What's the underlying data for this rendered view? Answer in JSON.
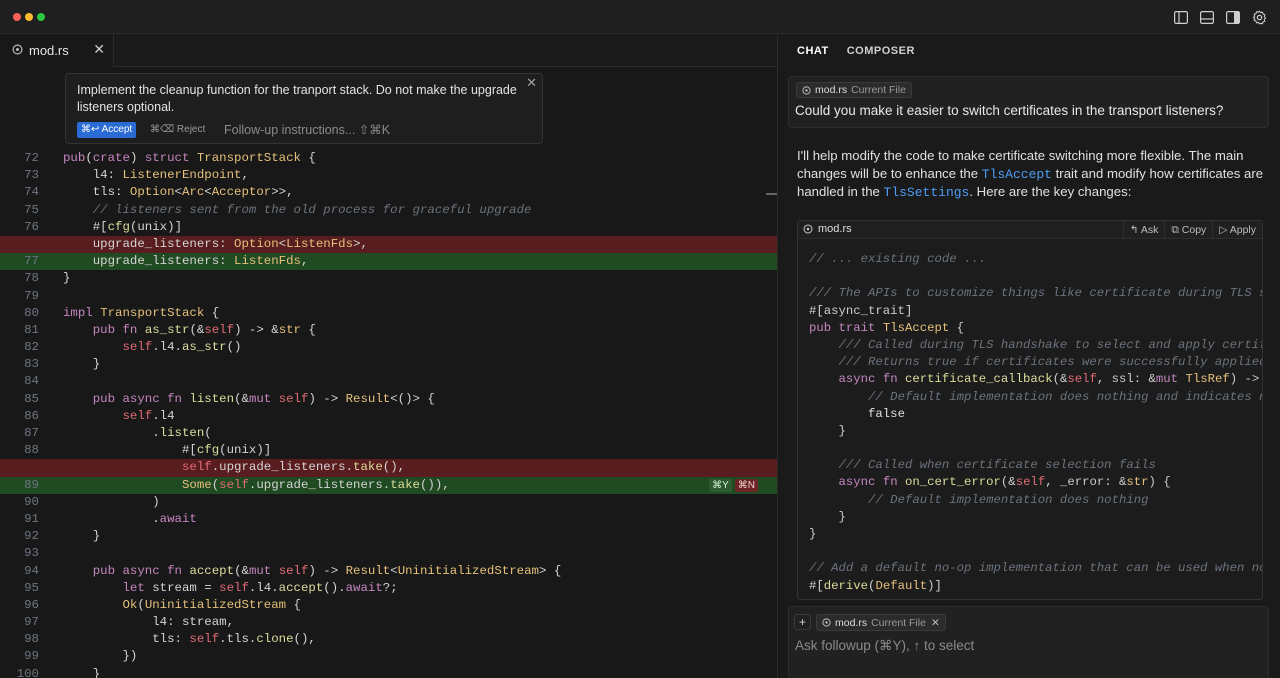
{
  "window": {
    "traffic_lights": [
      "#ff5f57",
      "#febc2e",
      "#28c840"
    ],
    "toolbar_icons": [
      "sidebar-left-icon",
      "panel-bottom-icon",
      "sidebar-right-icon",
      "gear-icon"
    ]
  },
  "editor": {
    "tab": {
      "label": "mod.rs",
      "close": "✕"
    },
    "prompt": {
      "text": "Implement the cleanup function for the tranport stack. Do not make the upgrade listeners optional.",
      "accept_label": "⌘↩ Accept",
      "reject_label": "⌘⌫ Reject",
      "followup_placeholder": "Follow-up instructions... ⇧⌘K",
      "close": "✕"
    },
    "inline_shortcuts": {
      "accept": "⌘Y",
      "reject": "⌘N"
    },
    "lines": [
      {
        "n": "72",
        "t": "",
        "html": "<span class=\"kw\">pub</span>(<span class=\"kw\">crate</span>) <span class=\"kw\">struct</span> <span class=\"ty\">TransportStack</span> {"
      },
      {
        "n": "73",
        "t": "",
        "html": "    l4: <span class=\"ty\">ListenerEndpoint</span>,"
      },
      {
        "n": "74",
        "t": "",
        "html": "    tls: <span class=\"ty\">Option</span>&lt;<span class=\"ty\">Arc</span>&lt;<span class=\"ty\">Acceptor</span>&gt;&gt;,"
      },
      {
        "n": "75",
        "t": "",
        "html": "    <span class=\"cm\">// listeners sent from the old process for graceful upgrade</span>"
      },
      {
        "n": "76",
        "t": "",
        "html": "    <span class=\"mc\">#[</span><span class=\"fn\">cfg</span>(unix)<span class=\"mc\">]</span>"
      },
      {
        "n": "",
        "t": "del",
        "html": "    upgrade_listeners: <span class=\"ty\">Option</span>&lt;<span class=\"ty\">ListenFds</span>&gt;,"
      },
      {
        "n": "77",
        "t": "add",
        "html": "    upgrade_listeners: <span class=\"ty\">ListenFds</span>,"
      },
      {
        "n": "78",
        "t": "",
        "html": "}"
      },
      {
        "n": "79",
        "t": "",
        "html": ""
      },
      {
        "n": "80",
        "t": "",
        "html": "<span class=\"kw\">impl</span> <span class=\"ty\">TransportStack</span> {"
      },
      {
        "n": "81",
        "t": "",
        "html": "    <span class=\"kw\">pub</span> <span class=\"kw\">fn</span> <span class=\"fn\">as_str</span>(&amp;<span class=\"sf\">self</span>) -&gt; &amp;<span class=\"ty\">str</span> {"
      },
      {
        "n": "82",
        "t": "",
        "html": "        <span class=\"sf\">self</span>.l4.<span class=\"fn\">as_str</span>()"
      },
      {
        "n": "83",
        "t": "",
        "html": "    }"
      },
      {
        "n": "84",
        "t": "",
        "html": ""
      },
      {
        "n": "85",
        "t": "",
        "html": "    <span class=\"kw\">pub</span> <span class=\"kw\">async</span> <span class=\"kw\">fn</span> <span class=\"fn\">listen</span>(&amp;<span class=\"kw\">mut</span> <span class=\"sf\">self</span>) -&gt; <span class=\"ty\">Result</span>&lt;()&gt; {"
      },
      {
        "n": "86",
        "t": "",
        "html": "        <span class=\"sf\">self</span>.l4"
      },
      {
        "n": "87",
        "t": "",
        "html": "            .<span class=\"fn\">listen</span>("
      },
      {
        "n": "88",
        "t": "",
        "html": "                <span class=\"mc\">#[</span><span class=\"fn\">cfg</span>(unix)<span class=\"mc\">]</span>"
      },
      {
        "n": "",
        "t": "del",
        "html": "                <span class=\"sf\">self</span>.upgrade_listeners.<span class=\"fn\">take</span>(),"
      },
      {
        "n": "89",
        "t": "add",
        "html": "                <span class=\"ty\">Some</span>(<span class=\"sf\">self</span>.upgrade_listeners.<span class=\"fn\">take</span>()),",
        "shortcuts": true
      },
      {
        "n": "90",
        "t": "",
        "html": "            )"
      },
      {
        "n": "91",
        "t": "",
        "html": "            .<span class=\"kw\">await</span>"
      },
      {
        "n": "92",
        "t": "",
        "html": "    }"
      },
      {
        "n": "93",
        "t": "",
        "html": ""
      },
      {
        "n": "94",
        "t": "",
        "html": "    <span class=\"kw\">pub</span> <span class=\"kw\">async</span> <span class=\"kw\">fn</span> <span class=\"fn\">accept</span>(&amp;<span class=\"kw\">mut</span> <span class=\"sf\">self</span>) -&gt; <span class=\"ty\">Result</span>&lt;<span class=\"ty\">UninitializedStream</span>&gt; {"
      },
      {
        "n": "95",
        "t": "",
        "html": "        <span class=\"kw\">let</span> stream = <span class=\"sf\">self</span>.l4.<span class=\"fn\">accept</span>().<span class=\"kw\">await</span>?;"
      },
      {
        "n": "96",
        "t": "",
        "html": "        <span class=\"ty\">Ok</span>(<span class=\"ty\">UninitializedStream</span> {"
      },
      {
        "n": "97",
        "t": "",
        "html": "            l4: stream,"
      },
      {
        "n": "98",
        "t": "",
        "html": "            tls: <span class=\"sf\">self</span>.tls.<span class=\"fn\">clone</span>(),"
      },
      {
        "n": "99",
        "t": "",
        "html": "        })"
      },
      {
        "n": "100",
        "t": "",
        "html": "    }"
      }
    ]
  },
  "chat": {
    "tabs": [
      "CHAT",
      "COMPOSER"
    ],
    "user_message": {
      "chip_file": "mod.rs",
      "chip_sub": "Current File",
      "text": "Could you make it easier to switch certificates in the transport listeners?"
    },
    "answer": {
      "part1": "I'll help modify the code to make certificate switching more flexible. The main changes will be to enhance the ",
      "ref1": "TlsAccept",
      "part2": " trait and modify how certificates are handled in the ",
      "ref2": "TlsSettings",
      "part3": ". Here are the key changes:"
    },
    "codeblock": {
      "file": "mod.rs",
      "actions": [
        "Ask",
        "Copy",
        "Apply"
      ],
      "lines": [
        "<span class=\"cm\">// ... existing code ...</span>",
        "",
        "<span class=\"cm\">/// The APIs to customize things like certificate during TLS ser</span>",
        "<span class=\"mc\">#[</span>async_trait<span class=\"mc\">]</span>",
        "<span class=\"kw\">pub</span> <span class=\"kw\">trait</span> <span class=\"ty\">TlsAccept</span> {",
        "    <span class=\"cm\">/// Called during TLS handshake to select and apply certific</span>",
        "    <span class=\"cm\">/// Returns true if certificates were successfully applied</span>",
        "    <span class=\"kw\">async</span> <span class=\"kw\">fn</span> <span class=\"fn\">certificate_callback</span>(&amp;<span class=\"sf\">self</span>, ssl: &amp;<span class=\"kw\">mut</span> <span class=\"ty\">TlsRef</span>) -&gt; <span class=\"ty\">bo</span>",
        "        <span class=\"cm\">// Default implementation does nothing and indicates no</span>",
        "        <span style=\"color:#e0e0e0\">false</span>",
        "    }",
        "",
        "    <span class=\"cm\">/// Called when certificate selection fails</span>",
        "    <span class=\"kw\">async</span> <span class=\"kw\">fn</span> <span class=\"fn\">on_cert_error</span>(&amp;<span class=\"sf\">self</span>, _error: &amp;<span class=\"ty\">str</span>) {",
        "        <span class=\"cm\">// Default implementation does nothing</span>",
        "    }",
        "}",
        "",
        "<span class=\"cm\">// Add a default no-op implementation that can be used when no c</span>",
        "<span class=\"mc\">#[</span><span class=\"fn\">derive</span>(<span class=\"ty\">Default</span>)<span class=\"mc\">]</span>"
      ]
    },
    "input": {
      "plus": "+",
      "chip_file": "mod.rs",
      "chip_sub": "Current File",
      "chip_close": "✕",
      "placeholder": "Ask followup (⌘Y), ↑ to select"
    }
  }
}
